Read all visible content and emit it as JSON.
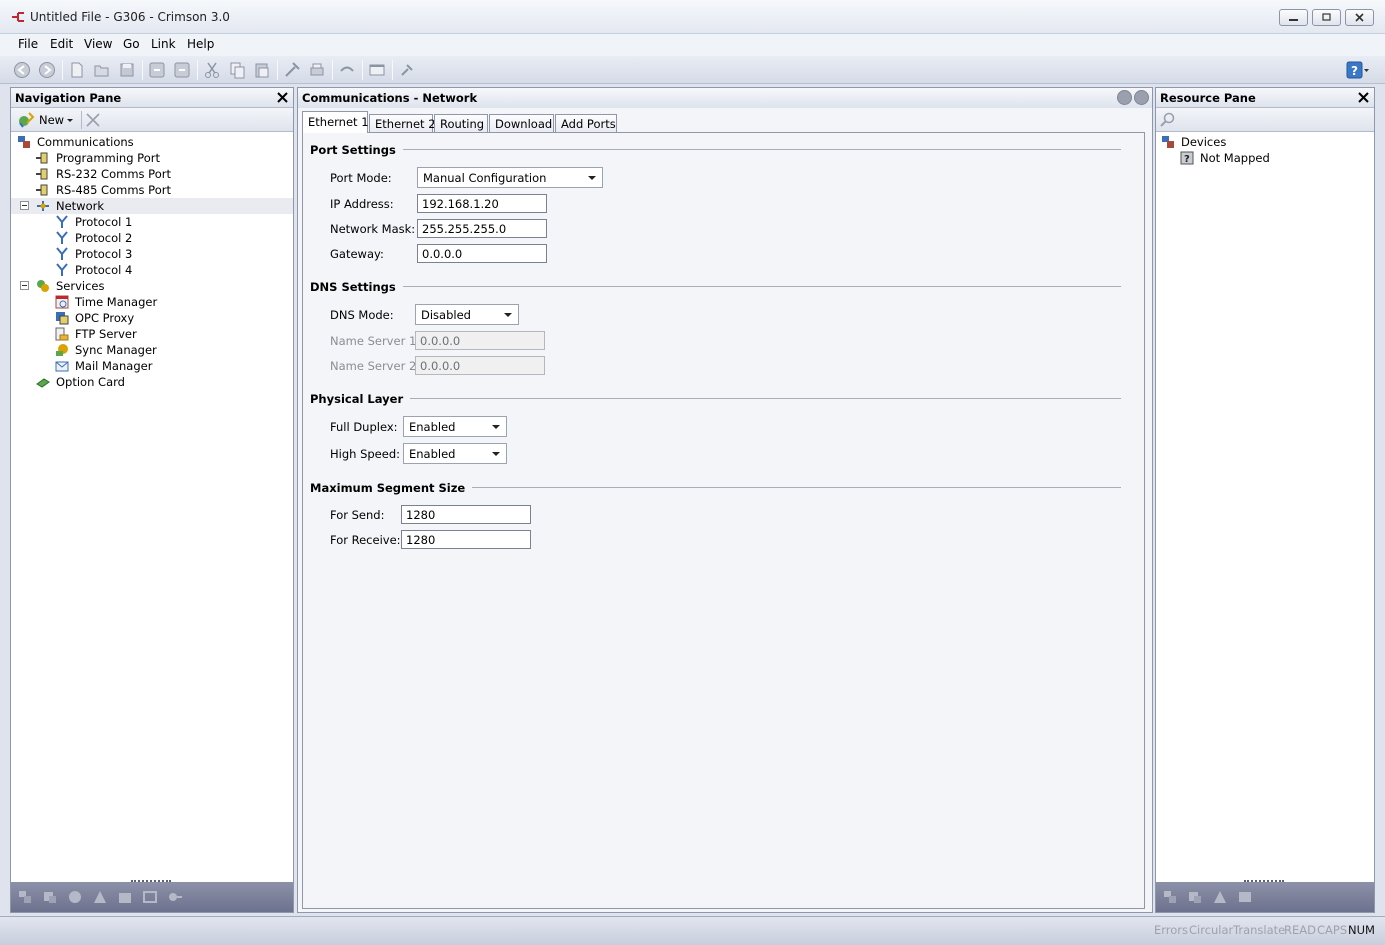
{
  "window": {
    "title": "Untitled File - G306 - Crimson 3.0",
    "app_icon": "crimson-logo-icon",
    "controls": [
      "minimize-icon",
      "restore-icon",
      "close-icon"
    ]
  },
  "menu": {
    "items": [
      {
        "label": "File"
      },
      {
        "label": "Edit"
      },
      {
        "label": "View"
      },
      {
        "label": "Go"
      },
      {
        "label": "Link"
      },
      {
        "label": "Help"
      }
    ]
  },
  "toolbar": {
    "icons": [
      "back-icon",
      "forward-icon",
      "new-file-icon",
      "open-icon",
      "save-icon",
      "undo-icon",
      "redo-icon",
      "cut-icon",
      "copy-icon",
      "paste-icon",
      "tools-icon",
      "print-icon",
      "link-icon",
      "window-icon",
      "pin-icon"
    ],
    "help_icon": "help-icon"
  },
  "navigation_pane": {
    "title": "Navigation Pane",
    "new_label": "New",
    "tree": [
      {
        "label": "Communications",
        "level": 0,
        "icon": "communications-icon"
      },
      {
        "label": "Programming Port",
        "level": 1,
        "icon": "port-icon"
      },
      {
        "label": "RS-232 Comms Port",
        "level": 1,
        "icon": "port-icon"
      },
      {
        "label": "RS-485 Comms Port",
        "level": 1,
        "icon": "port-icon"
      },
      {
        "label": "Network",
        "level": 1,
        "icon": "network-icon",
        "expanded": true,
        "selected": true
      },
      {
        "label": "Protocol 1",
        "level": 2,
        "icon": "protocol-icon"
      },
      {
        "label": "Protocol 2",
        "level": 2,
        "icon": "protocol-icon"
      },
      {
        "label": "Protocol 3",
        "level": 2,
        "icon": "protocol-icon"
      },
      {
        "label": "Protocol 4",
        "level": 2,
        "icon": "protocol-icon"
      },
      {
        "label": "Services",
        "level": 1,
        "icon": "services-icon",
        "expanded": true
      },
      {
        "label": "Time Manager",
        "level": 2,
        "icon": "time-manager-icon"
      },
      {
        "label": "OPC Proxy",
        "level": 2,
        "icon": "opc-proxy-icon"
      },
      {
        "label": "FTP Server",
        "level": 2,
        "icon": "ftp-server-icon"
      },
      {
        "label": "Sync Manager",
        "level": 2,
        "icon": "sync-manager-icon"
      },
      {
        "label": "Mail Manager",
        "level": 2,
        "icon": "mail-manager-icon"
      },
      {
        "label": "Option Card",
        "level": 1,
        "icon": "option-card-icon"
      }
    ]
  },
  "center": {
    "title": "Communications - Network",
    "tabs": [
      {
        "label": "Ethernet 1",
        "active": true
      },
      {
        "label": "Ethernet 2"
      },
      {
        "label": "Routing"
      },
      {
        "label": "Download"
      },
      {
        "label": "Add Ports"
      }
    ],
    "port_settings": {
      "title": "Port Settings",
      "port_mode_label": "Port Mode:",
      "port_mode_value": "Manual Configuration",
      "ip_label": "IP Address:",
      "ip_value": "192.168.1.20",
      "mask_label": "Network Mask:",
      "mask_value": "255.255.255.0",
      "gateway_label": "Gateway:",
      "gateway_value": "0.0.0.0"
    },
    "dns_settings": {
      "title": "DNS Settings",
      "mode_label": "DNS Mode:",
      "mode_value": "Disabled",
      "ns1_label": "Name Server 1:",
      "ns1_value": "0.0.0.0",
      "ns2_label": "Name Server 2:",
      "ns2_value": "0.0.0.0"
    },
    "physical_layer": {
      "title": "Physical Layer",
      "duplex_label": "Full Duplex:",
      "duplex_value": "Enabled",
      "speed_label": "High Speed:",
      "speed_value": "Enabled"
    },
    "segment_size": {
      "title": "Maximum Segment Size",
      "send_label": "For Send:",
      "send_value": "1280",
      "receive_label": "For Receive:",
      "receive_value": "1280"
    }
  },
  "resource_pane": {
    "title": "Resource Pane",
    "tree": [
      {
        "label": "Devices",
        "level": 0,
        "icon": "devices-icon"
      },
      {
        "label": "Not Mapped",
        "level": 1,
        "icon": "unknown-icon"
      }
    ]
  },
  "status_bar": {
    "items": [
      {
        "label": "Errors",
        "active": false
      },
      {
        "label": "Circular",
        "active": false
      },
      {
        "label": "Translate",
        "active": false
      },
      {
        "label": "READ",
        "active": false
      },
      {
        "label": "CAPS",
        "active": false
      },
      {
        "label": "NUM",
        "active": true
      }
    ]
  }
}
